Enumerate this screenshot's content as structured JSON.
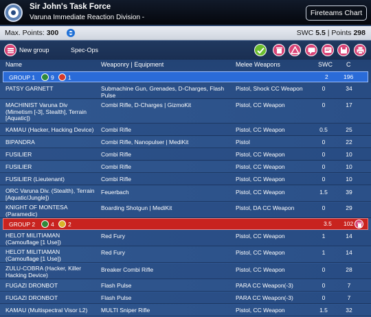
{
  "header": {
    "title": "Sir John's Task Force",
    "subtitle": "Varuna Immediate Reaction Division -",
    "fireteams_button": "Fireteams Chart"
  },
  "points_bar": {
    "max_label": "Max. Points:",
    "max_value": "300",
    "swc_label": "SWC",
    "swc_value": "5.5",
    "points_label": "| Points",
    "points_value": "298"
  },
  "toolbar": {
    "new_group": "New group",
    "spec_ops": "Spec-Ops",
    "buttons": [
      "check-icon",
      "trash-icon",
      "warning-icon",
      "chat-icon",
      "message-icon",
      "save-icon",
      "print-icon"
    ]
  },
  "columns": {
    "name": "Name",
    "weaponry": "Weaponry | Equipment",
    "melee": "Melee Weapons",
    "swc": "SWC",
    "c": "C"
  },
  "groups": [
    {
      "label": "GROUP 1",
      "badges": [
        {
          "icon": "regular-order-icon",
          "count": "9"
        },
        {
          "icon": "irregular-order-icon",
          "count": "1"
        }
      ],
      "swc": "2",
      "points": "196",
      "units": [
        {
          "name": "PATSY GARNETT",
          "weapons": "Submachine Gun, Grenades, D-Charges, Flash Pulse",
          "melee": "Pistol, Shock CC Weapon",
          "swc": "0",
          "points": "34"
        },
        {
          "name": "MACHINIST Varuna Div (Mimetism [-3], Stealth], Terrain [Aquatic])",
          "weapons": "Combi Rifle, D-Charges | GizmoKit",
          "melee": "Pistol, CC Weapon",
          "swc": "0",
          "points": "17"
        },
        {
          "name": "KAMAU (Hacker, Hacking Device)",
          "weapons": "Combi Rifle",
          "melee": "Pistol, CC Weapon",
          "swc": "0.5",
          "points": "25"
        },
        {
          "name": "BIPANDRA",
          "weapons": "Combi Rifle, Nanopulser | MediKit",
          "melee": "Pistol",
          "swc": "0",
          "points": "22"
        },
        {
          "name": "FUSILIER",
          "weapons": "Combi Rifle",
          "melee": "Pistol, CC Weapon",
          "swc": "0",
          "points": "10"
        },
        {
          "name": "FUSILIER",
          "weapons": "Combi Rifle",
          "melee": "Pistol, CC Weapon",
          "swc": "0",
          "points": "10"
        },
        {
          "name": "FUSILIER (Lieutenant)",
          "weapons": "Combi Rifle",
          "melee": "Pistol, CC Weapon",
          "swc": "0",
          "points": "10"
        },
        {
          "name": "ORC Varuna Div. (Stealth), Terrain [Aquatic/Jungle])",
          "weapons": "Feuerbach",
          "melee": "Pistol, CC Weapon",
          "swc": "1.5",
          "points": "39"
        },
        {
          "name": "KNIGHT OF MONTESA (Paramedic)",
          "weapons": "Boarding Shotgun | MediKit",
          "melee": "Pistol, DA CC Weapon",
          "swc": "0",
          "points": "29"
        }
      ]
    },
    {
      "label": "GROUP 2",
      "badges": [
        {
          "icon": "regular-order-icon",
          "count": "4"
        },
        {
          "icon": "impetuous-order-icon",
          "count": "2"
        }
      ],
      "swc": "3.5",
      "points": "102",
      "units": [
        {
          "name": "HELOT MILITIAMAN (Camouflage [1 Use])",
          "weapons": "Red Fury",
          "melee": "Pistol, CC Weapon",
          "swc": "1",
          "points": "14"
        },
        {
          "name": "HELOT MILITIAMAN (Camouflage [1 Use])",
          "weapons": "Red Fury",
          "melee": "Pistol, CC Weapon",
          "swc": "1",
          "points": "14"
        },
        {
          "name": "ZULU-COBRA (Hacker, Killer Hacking Device)",
          "weapons": "Breaker Combi Rifle",
          "melee": "Pistol, CC Weapon",
          "swc": "0",
          "points": "28"
        },
        {
          "name": "FUGAZI DRONBOT",
          "weapons": "Flash Pulse",
          "melee": "PARA CC Weapon(-3)",
          "swc": "0",
          "points": "7"
        },
        {
          "name": "FUGAZI DRONBOT",
          "weapons": "Flash Pulse",
          "melee": "PARA CC Weapon(-3)",
          "swc": "0",
          "points": "7"
        },
        {
          "name": "KAMAU (Multispectral Visor L2)",
          "weapons": "MULTI Sniper Rifle",
          "melee": "Pistol, CC Weapon",
          "swc": "1.5",
          "points": "32"
        }
      ]
    }
  ]
}
